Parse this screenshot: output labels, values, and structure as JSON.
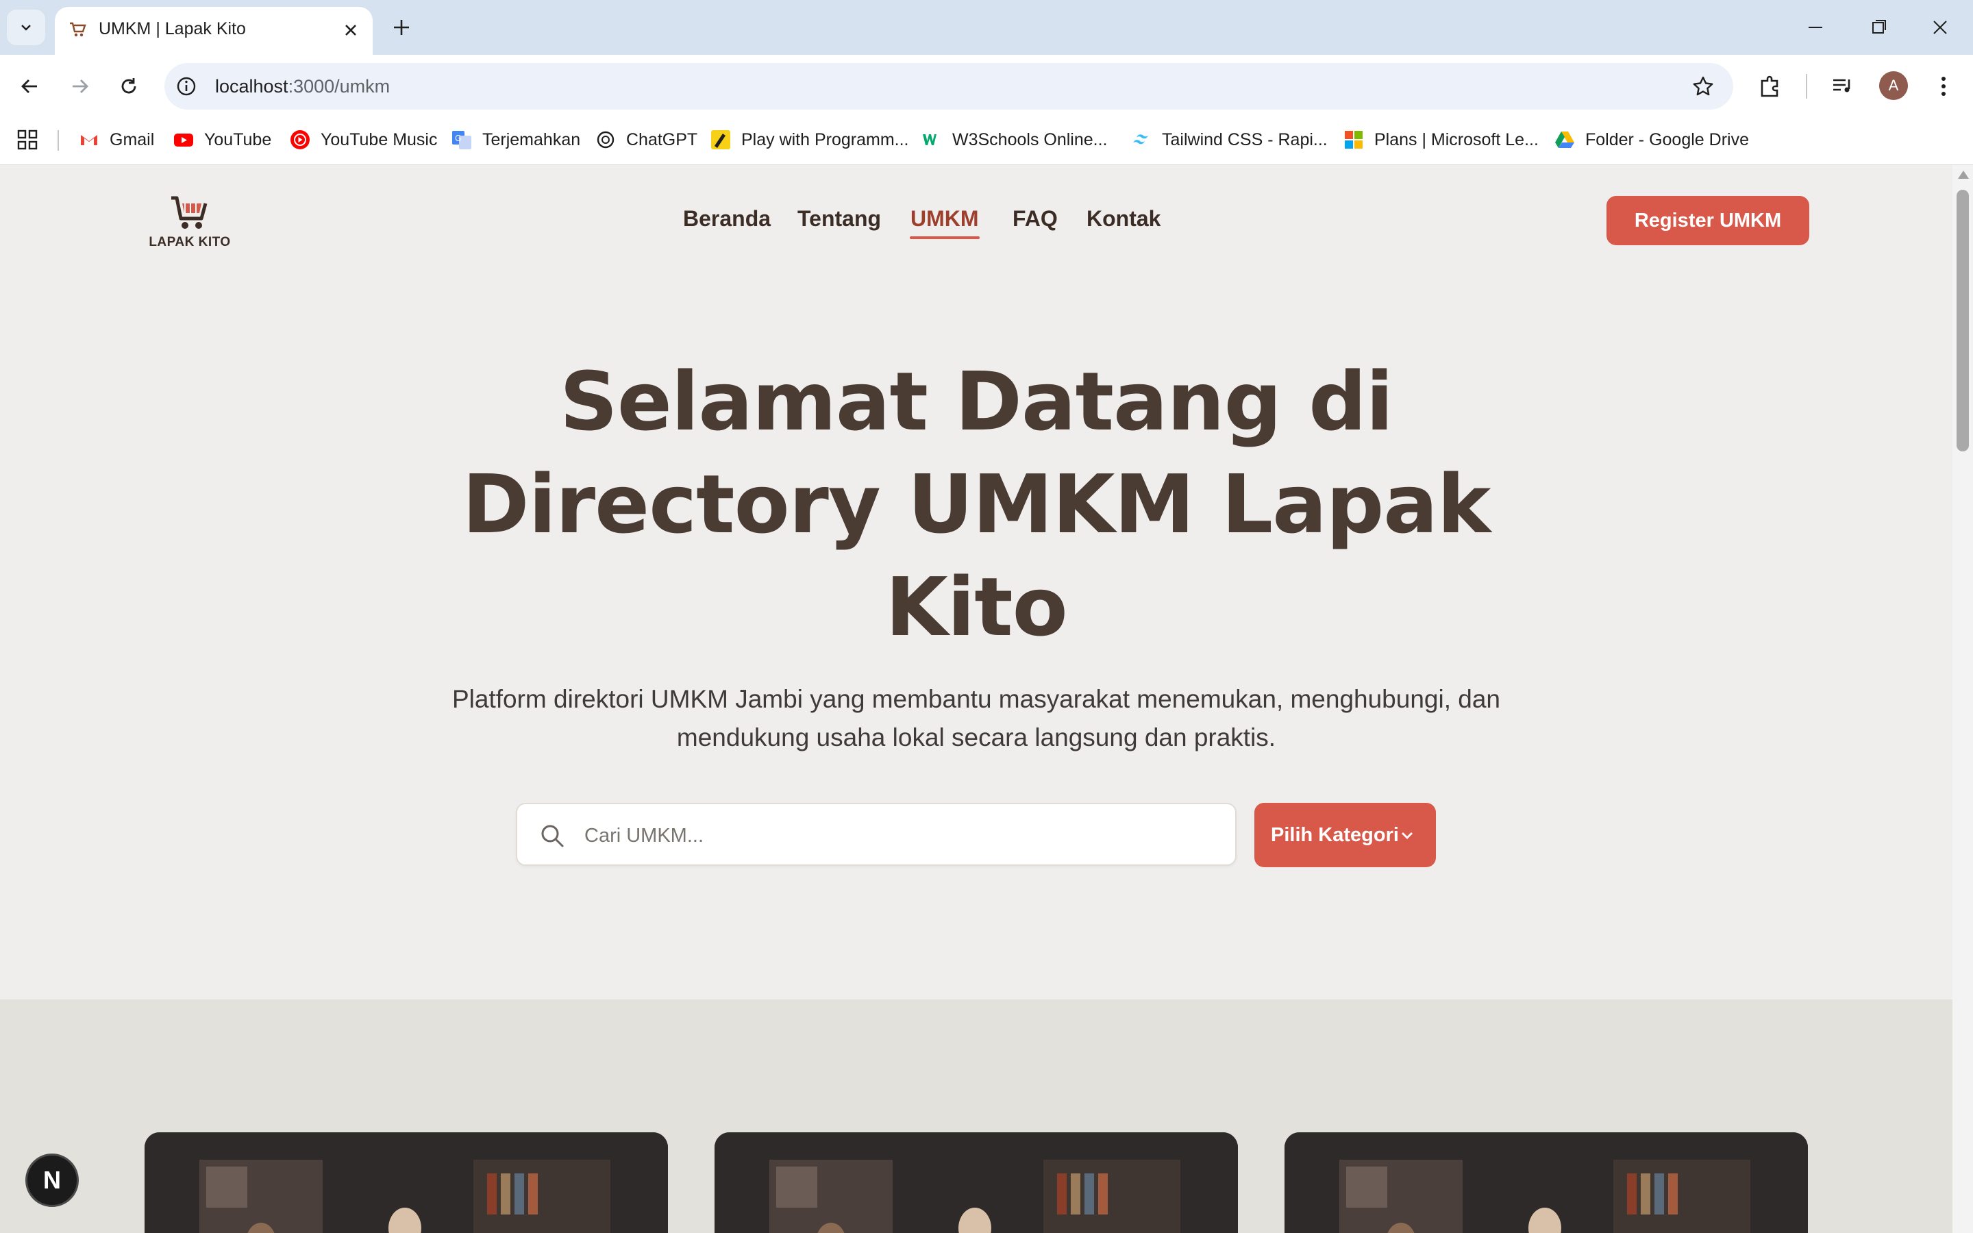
{
  "browser": {
    "tab_title": "UMKM | Lapak Kito",
    "url_host": "localhost",
    "url_path": ":3000/umkm",
    "profile_initial": "A",
    "bookmarks": [
      {
        "label": "Gmail",
        "icon": "gmail-icon"
      },
      {
        "label": "YouTube",
        "icon": "youtube-icon"
      },
      {
        "label": "YouTube Music",
        "icon": "youtube-music-icon"
      },
      {
        "label": "Terjemahkan",
        "icon": "translate-icon"
      },
      {
        "label": "ChatGPT",
        "icon": "chatgpt-icon"
      },
      {
        "label": "Play with Programm...",
        "icon": "play-programming-icon"
      },
      {
        "label": "W3Schools Online...",
        "icon": "w3schools-icon"
      },
      {
        "label": "Tailwind CSS - Rapi...",
        "icon": "tailwind-icon"
      },
      {
        "label": "Plans | Microsoft Le...",
        "icon": "microsoft-icon"
      },
      {
        "label": "Folder - Google Drive",
        "icon": "google-drive-icon"
      }
    ]
  },
  "site": {
    "logo_text": "LAPAK KITO",
    "nav": [
      "Beranda",
      "Tentang",
      "UMKM",
      "FAQ",
      "Kontak"
    ],
    "active_nav": "UMKM",
    "register_label": "Register UMKM"
  },
  "hero": {
    "title": "Selamat Datang di Directory UMKM Lapak Kito",
    "subtitle": "Platform direktori UMKM Jambi yang membantu masyarakat menemukan, menghubungi, dan mendukung usaha lokal secara langsung dan praktis.",
    "search_placeholder": "Cari UMKM...",
    "category_label": "Pilih Kategori"
  },
  "dev_badge": "N",
  "colors": {
    "accent": "#d8584a",
    "text_dark": "#4a3b33",
    "page_bg": "#efeeec"
  }
}
